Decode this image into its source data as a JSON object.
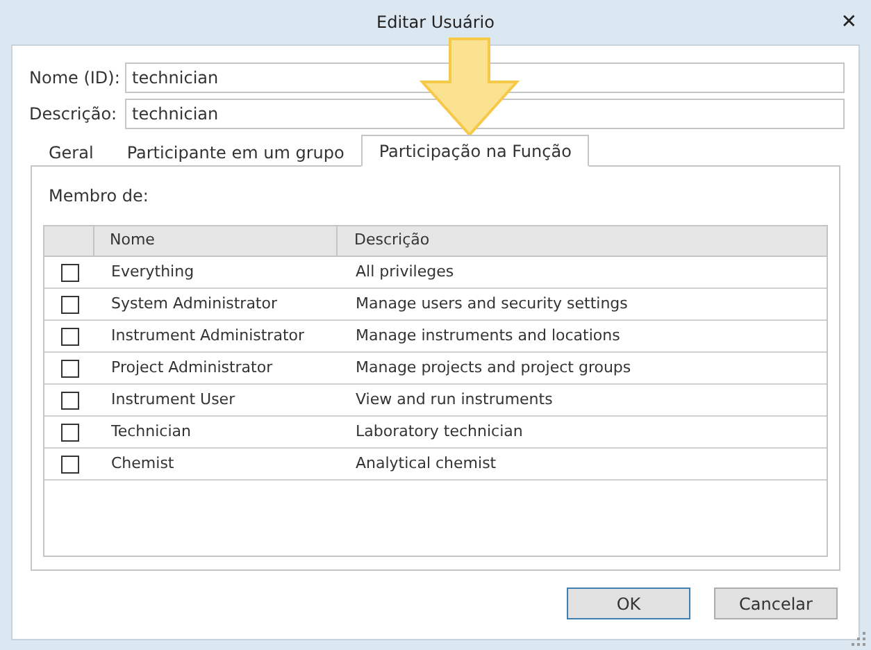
{
  "window": {
    "title": "Editar Usuário",
    "close": "✕"
  },
  "fields": [
    {
      "label": "Nome (ID):",
      "value": "technician"
    },
    {
      "label": "Descrição:",
      "value": "technician"
    }
  ],
  "tabs": [
    {
      "label": "Geral",
      "selected": false
    },
    {
      "label": "Participante em um grupo",
      "selected": false
    },
    {
      "label": "Participação na Função",
      "selected": true
    }
  ],
  "section_label": "Membro de:",
  "table": {
    "columns": [
      "Nome",
      "Descrição"
    ],
    "rows": [
      {
        "checked": false,
        "name": "Everything",
        "description": "All privileges"
      },
      {
        "checked": false,
        "name": "System Administrator",
        "description": "Manage users and security settings"
      },
      {
        "checked": false,
        "name": "Instrument Administrator",
        "description": "Manage instruments and locations"
      },
      {
        "checked": false,
        "name": "Project Administrator",
        "description": "Manage projects and project groups"
      },
      {
        "checked": false,
        "name": "Instrument User",
        "description": "View and run instruments"
      },
      {
        "checked": false,
        "name": "Technician",
        "description": "Laboratory technician"
      },
      {
        "checked": false,
        "name": "Chemist",
        "description": "Analytical chemist"
      }
    ]
  },
  "buttons": [
    "OK",
    "Cancelar"
  ]
}
